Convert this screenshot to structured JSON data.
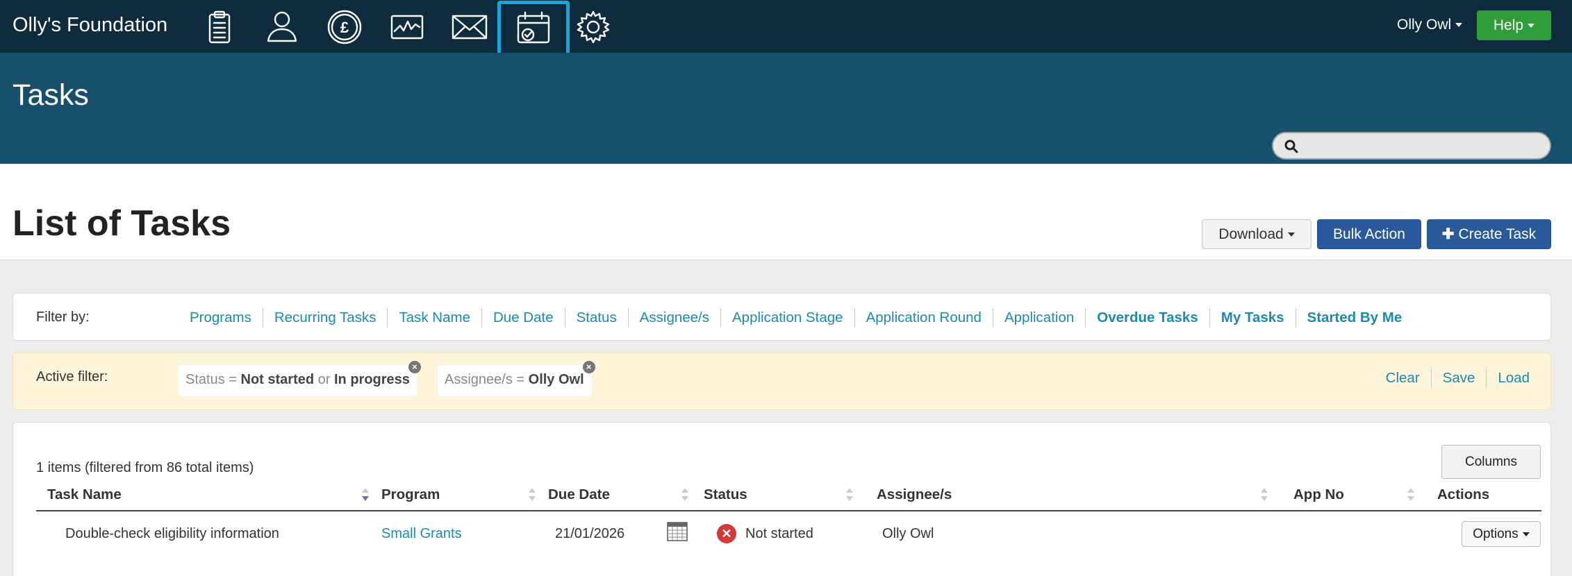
{
  "app": {
    "brand": "Olly's Foundation",
    "nav_icons": [
      "clipboard-icon",
      "person-icon",
      "pound-coin-icon",
      "activity-chart-icon",
      "envelope-icon",
      "calendar-check-icon",
      "gear-icon"
    ],
    "active_nav": "calendar-check-icon",
    "user": "Olly Owl",
    "help": "Help"
  },
  "header": {
    "title": "Tasks",
    "search_placeholder": ""
  },
  "list": {
    "title": "List of Tasks",
    "download": "Download",
    "bulk_action": "Bulk Action",
    "create_task": "Create Task"
  },
  "filter": {
    "label": "Filter by:",
    "links": [
      "Programs",
      "Recurring Tasks",
      "Task Name",
      "Due Date",
      "Status",
      "Assignee/s",
      "Application Stage",
      "Application Round",
      "Application",
      "Overdue Tasks",
      "My Tasks",
      "Started By Me"
    ]
  },
  "active_filter": {
    "label": "Active filter:",
    "status_key": "Status =",
    "status_value_1": "Not started",
    "status_or": "or",
    "status_value_2": "In progress",
    "assignee_key": "Assignee/s =",
    "assignee_value": "Olly Owl",
    "clear": "Clear",
    "save": "Save",
    "load": "Load"
  },
  "results": {
    "count_text": "1 items (filtered from 86 total items)",
    "columns_button": "Columns",
    "headers": [
      "Task Name",
      "Program",
      "Due Date",
      "Status",
      "Assignee/s",
      "App No",
      "Actions"
    ],
    "rows": [
      {
        "task_name": "Double-check eligibility information",
        "program": "Small Grants",
        "due_date": "21/01/2026",
        "status": "Not started",
        "assignee": "Olly Owl",
        "app_no": "",
        "action": "Options"
      }
    ]
  },
  "colors": {
    "topnav": "#0e2c3d",
    "header_band": "#17506c",
    "active_highlight": "#1aa5d9",
    "help_green": "#2f9d39",
    "primary_blue": "#2b5a9c",
    "link": "#1a8ab4",
    "active_filter_bg": "#fdf4d9",
    "status_not_started": "#d33a3a"
  }
}
